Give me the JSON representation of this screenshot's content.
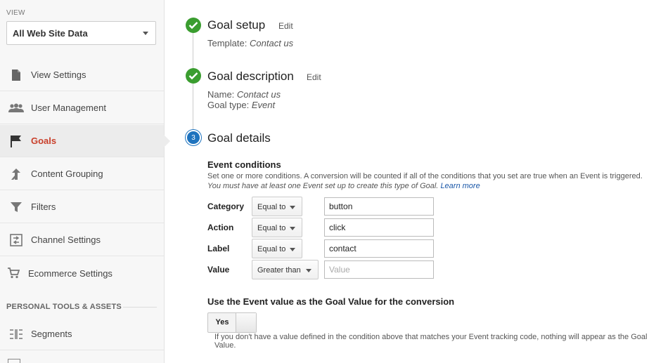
{
  "sidebar": {
    "view_label": "VIEW",
    "view_selected": "All Web Site Data",
    "items": [
      {
        "label": "View Settings",
        "icon": "document-icon"
      },
      {
        "label": "User Management",
        "icon": "users-icon"
      },
      {
        "label": "Goals",
        "icon": "flag-icon",
        "active": true
      },
      {
        "label": "Content Grouping",
        "icon": "grouping-icon"
      },
      {
        "label": "Filters",
        "icon": "filter-icon"
      },
      {
        "label": "Channel Settings",
        "icon": "channel-icon"
      },
      {
        "label": "Ecommerce Settings",
        "icon": "cart-icon"
      }
    ],
    "section_title": "PERSONAL TOOLS & ASSETS",
    "section_items": [
      {
        "label": "Segments",
        "icon": "segments-icon"
      }
    ]
  },
  "steps": {
    "setup": {
      "title": "Goal setup",
      "edit": "Edit",
      "template_label": "Template:",
      "template_value": "Contact us"
    },
    "description": {
      "title": "Goal description",
      "edit": "Edit",
      "name_label": "Name:",
      "name_value": "Contact us",
      "type_label": "Goal type:",
      "type_value": "Event"
    },
    "details": {
      "number": "3",
      "title": "Goal details"
    }
  },
  "event_conditions": {
    "title": "Event conditions",
    "help_line1": "Set one or more conditions. A conversion will be counted if all of the conditions that you set are true when an Event is triggered.",
    "help_line2": "You must have at least one Event set up to create this type of Goal.",
    "learn_more": "Learn more",
    "rows": [
      {
        "label": "Category",
        "operator": "Equal to",
        "value": "button",
        "placeholder": ""
      },
      {
        "label": "Action",
        "operator": "Equal to",
        "value": "click",
        "placeholder": ""
      },
      {
        "label": "Label",
        "operator": "Equal to",
        "value": "contact",
        "placeholder": ""
      },
      {
        "label": "Value",
        "operator": "Greater than",
        "value": "",
        "placeholder": "Value"
      }
    ]
  },
  "goal_value": {
    "title": "Use the Event value as the Goal Value for the conversion",
    "toggle_label": "Yes",
    "note": "If you don't have a value defined in the condition above that matches your Event tracking code, nothing will appear as the Goal Value."
  },
  "colors": {
    "done": "#3a9d2f",
    "current": "#1e73be",
    "active_nav": "#c9402b",
    "link": "#1a57a8"
  }
}
